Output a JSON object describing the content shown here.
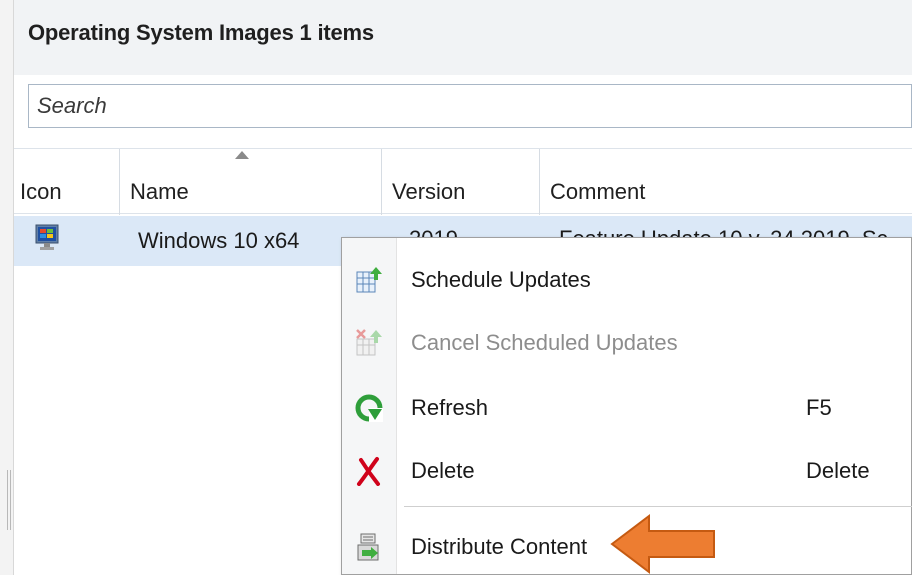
{
  "header": {
    "title": "Operating System Images 1 items"
  },
  "search": {
    "placeholder": "Search"
  },
  "columns": [
    {
      "label": "Icon"
    },
    {
      "label": "Name"
    },
    {
      "label": "Version"
    },
    {
      "label": "Comment"
    }
  ],
  "rows": [
    {
      "name": "Windows 10 x64",
      "version": "2019",
      "comment": "Feature Update 10 v. 24 2019, Sc"
    }
  ],
  "context_menu": {
    "items": [
      {
        "label": "Schedule Updates",
        "icon": "schedule-updates-icon",
        "shortcut": "",
        "enabled": true
      },
      {
        "label": "Cancel Scheduled Updates",
        "icon": "cancel-scheduled-updates-icon",
        "shortcut": "",
        "enabled": false
      },
      {
        "label": "Refresh",
        "icon": "refresh-icon",
        "shortcut": "F5",
        "enabled": true
      },
      {
        "label": "Delete",
        "icon": "delete-icon",
        "shortcut": "Delete",
        "enabled": true
      },
      {
        "label": "Distribute Content",
        "icon": "distribute-content-icon",
        "shortcut": "",
        "enabled": true
      }
    ]
  },
  "colors": {
    "selected_row": "#dbe8f7",
    "callout_arrow": "#ed7d31",
    "refresh_green": "#2e9e3a",
    "delete_red": "#d0021b"
  }
}
